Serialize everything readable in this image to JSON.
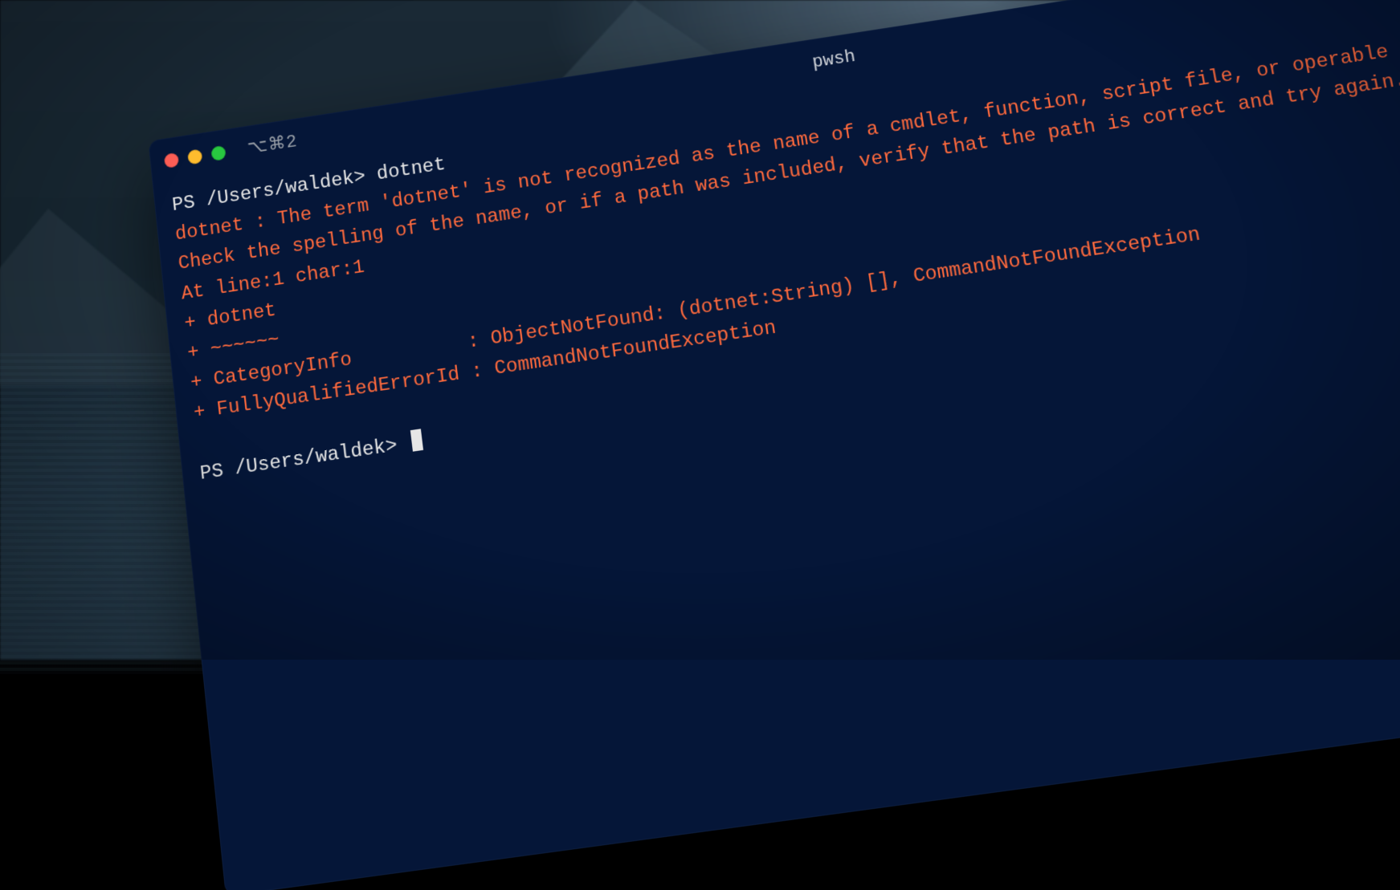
{
  "window": {
    "title": "pwsh",
    "shortcut": "⌥⌘2"
  },
  "terminal": {
    "prompt1": "PS /Users/waldek>",
    "command": "dotnet",
    "error_lines": [
      "dotnet : The term 'dotnet' is not recognized as the name of a cmdlet, function, script file, or operable program.",
      "Check the spelling of the name, or if a path was included, verify that the path is correct and try again.",
      "At line:1 char:1",
      "+ dotnet",
      "+ ~~~~~~",
      "+ CategoryInfo          : ObjectNotFound: (dotnet:String) [], CommandNotFoundException",
      "+ FullyQualifiedErrorId : CommandNotFoundException"
    ],
    "prompt2": "PS /Users/waldek>"
  },
  "colors": {
    "terminal_bg": "#051638",
    "error_fg": "#ff6a3d",
    "text_fg": "#e6e6e6",
    "traffic_red": "#ff5f57",
    "traffic_yellow": "#febc2e",
    "traffic_green": "#28c840"
  }
}
